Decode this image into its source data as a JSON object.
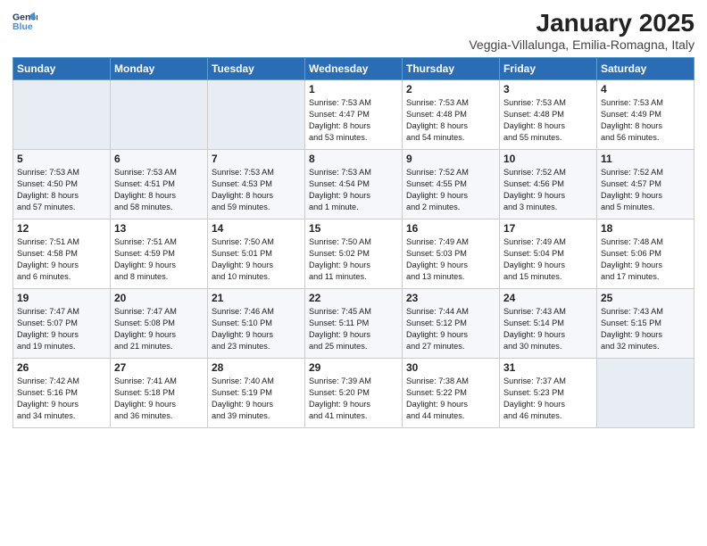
{
  "logo": {
    "line1": "General",
    "line2": "Blue"
  },
  "title": "January 2025",
  "location": "Veggia-Villalunga, Emilia-Romagna, Italy",
  "days_of_week": [
    "Sunday",
    "Monday",
    "Tuesday",
    "Wednesday",
    "Thursday",
    "Friday",
    "Saturday"
  ],
  "weeks": [
    [
      {
        "day": "",
        "info": ""
      },
      {
        "day": "",
        "info": ""
      },
      {
        "day": "",
        "info": ""
      },
      {
        "day": "1",
        "info": "Sunrise: 7:53 AM\nSunset: 4:47 PM\nDaylight: 8 hours\nand 53 minutes."
      },
      {
        "day": "2",
        "info": "Sunrise: 7:53 AM\nSunset: 4:48 PM\nDaylight: 8 hours\nand 54 minutes."
      },
      {
        "day": "3",
        "info": "Sunrise: 7:53 AM\nSunset: 4:48 PM\nDaylight: 8 hours\nand 55 minutes."
      },
      {
        "day": "4",
        "info": "Sunrise: 7:53 AM\nSunset: 4:49 PM\nDaylight: 8 hours\nand 56 minutes."
      }
    ],
    [
      {
        "day": "5",
        "info": "Sunrise: 7:53 AM\nSunset: 4:50 PM\nDaylight: 8 hours\nand 57 minutes."
      },
      {
        "day": "6",
        "info": "Sunrise: 7:53 AM\nSunset: 4:51 PM\nDaylight: 8 hours\nand 58 minutes."
      },
      {
        "day": "7",
        "info": "Sunrise: 7:53 AM\nSunset: 4:53 PM\nDaylight: 8 hours\nand 59 minutes."
      },
      {
        "day": "8",
        "info": "Sunrise: 7:53 AM\nSunset: 4:54 PM\nDaylight: 9 hours\nand 1 minute."
      },
      {
        "day": "9",
        "info": "Sunrise: 7:52 AM\nSunset: 4:55 PM\nDaylight: 9 hours\nand 2 minutes."
      },
      {
        "day": "10",
        "info": "Sunrise: 7:52 AM\nSunset: 4:56 PM\nDaylight: 9 hours\nand 3 minutes."
      },
      {
        "day": "11",
        "info": "Sunrise: 7:52 AM\nSunset: 4:57 PM\nDaylight: 9 hours\nand 5 minutes."
      }
    ],
    [
      {
        "day": "12",
        "info": "Sunrise: 7:51 AM\nSunset: 4:58 PM\nDaylight: 9 hours\nand 6 minutes."
      },
      {
        "day": "13",
        "info": "Sunrise: 7:51 AM\nSunset: 4:59 PM\nDaylight: 9 hours\nand 8 minutes."
      },
      {
        "day": "14",
        "info": "Sunrise: 7:50 AM\nSunset: 5:01 PM\nDaylight: 9 hours\nand 10 minutes."
      },
      {
        "day": "15",
        "info": "Sunrise: 7:50 AM\nSunset: 5:02 PM\nDaylight: 9 hours\nand 11 minutes."
      },
      {
        "day": "16",
        "info": "Sunrise: 7:49 AM\nSunset: 5:03 PM\nDaylight: 9 hours\nand 13 minutes."
      },
      {
        "day": "17",
        "info": "Sunrise: 7:49 AM\nSunset: 5:04 PM\nDaylight: 9 hours\nand 15 minutes."
      },
      {
        "day": "18",
        "info": "Sunrise: 7:48 AM\nSunset: 5:06 PM\nDaylight: 9 hours\nand 17 minutes."
      }
    ],
    [
      {
        "day": "19",
        "info": "Sunrise: 7:47 AM\nSunset: 5:07 PM\nDaylight: 9 hours\nand 19 minutes."
      },
      {
        "day": "20",
        "info": "Sunrise: 7:47 AM\nSunset: 5:08 PM\nDaylight: 9 hours\nand 21 minutes."
      },
      {
        "day": "21",
        "info": "Sunrise: 7:46 AM\nSunset: 5:10 PM\nDaylight: 9 hours\nand 23 minutes."
      },
      {
        "day": "22",
        "info": "Sunrise: 7:45 AM\nSunset: 5:11 PM\nDaylight: 9 hours\nand 25 minutes."
      },
      {
        "day": "23",
        "info": "Sunrise: 7:44 AM\nSunset: 5:12 PM\nDaylight: 9 hours\nand 27 minutes."
      },
      {
        "day": "24",
        "info": "Sunrise: 7:43 AM\nSunset: 5:14 PM\nDaylight: 9 hours\nand 30 minutes."
      },
      {
        "day": "25",
        "info": "Sunrise: 7:43 AM\nSunset: 5:15 PM\nDaylight: 9 hours\nand 32 minutes."
      }
    ],
    [
      {
        "day": "26",
        "info": "Sunrise: 7:42 AM\nSunset: 5:16 PM\nDaylight: 9 hours\nand 34 minutes."
      },
      {
        "day": "27",
        "info": "Sunrise: 7:41 AM\nSunset: 5:18 PM\nDaylight: 9 hours\nand 36 minutes."
      },
      {
        "day": "28",
        "info": "Sunrise: 7:40 AM\nSunset: 5:19 PM\nDaylight: 9 hours\nand 39 minutes."
      },
      {
        "day": "29",
        "info": "Sunrise: 7:39 AM\nSunset: 5:20 PM\nDaylight: 9 hours\nand 41 minutes."
      },
      {
        "day": "30",
        "info": "Sunrise: 7:38 AM\nSunset: 5:22 PM\nDaylight: 9 hours\nand 44 minutes."
      },
      {
        "day": "31",
        "info": "Sunrise: 7:37 AM\nSunset: 5:23 PM\nDaylight: 9 hours\nand 46 minutes."
      },
      {
        "day": "",
        "info": ""
      }
    ]
  ]
}
